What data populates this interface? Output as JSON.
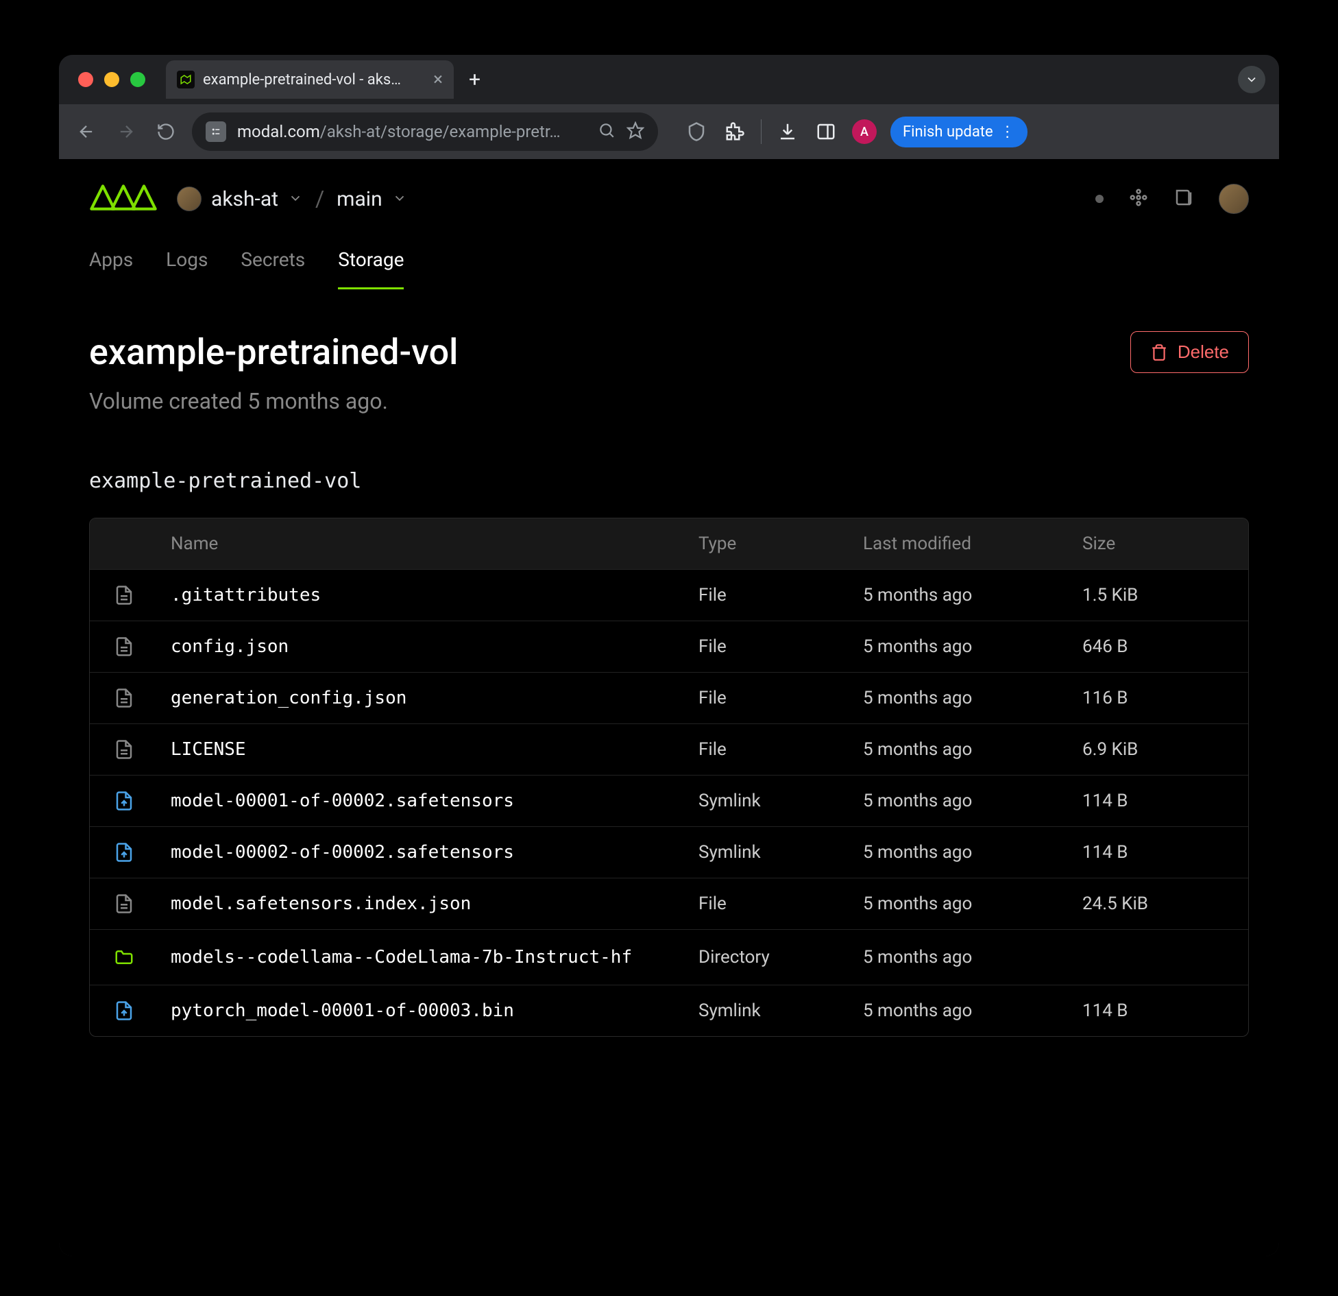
{
  "browser": {
    "tab_title": "example-pretrained-vol - aks…",
    "url_host": "modal.com",
    "url_path": "/aksh-at/storage/example-pretr…",
    "finish_update_label": "Finish update",
    "profile_initial": "A"
  },
  "header": {
    "org": "aksh-at",
    "env": "main"
  },
  "nav": {
    "tabs": [
      "Apps",
      "Logs",
      "Secrets",
      "Storage"
    ],
    "active": "Storage"
  },
  "page": {
    "title": "example-pretrained-vol",
    "subtitle": "Volume created 5 months ago.",
    "breadcrumb": "example-pretrained-vol",
    "delete_label": "Delete"
  },
  "table": {
    "columns": [
      "Name",
      "Type",
      "Last modified",
      "Size"
    ],
    "rows": [
      {
        "icon": "file",
        "name": ".gitattributes",
        "type": "File",
        "modified": "5 months ago",
        "size": "1.5 KiB"
      },
      {
        "icon": "file",
        "name": "config.json",
        "type": "File",
        "modified": "5 months ago",
        "size": "646 B"
      },
      {
        "icon": "file",
        "name": "generation_config.json",
        "type": "File",
        "modified": "5 months ago",
        "size": "116 B"
      },
      {
        "icon": "file",
        "name": "LICENSE",
        "type": "File",
        "modified": "5 months ago",
        "size": "6.9 KiB"
      },
      {
        "icon": "symlink",
        "name": "model-00001-of-00002.safetensors",
        "type": "Symlink",
        "modified": "5 months ago",
        "size": "114 B"
      },
      {
        "icon": "symlink",
        "name": "model-00002-of-00002.safetensors",
        "type": "Symlink",
        "modified": "5 months ago",
        "size": "114 B"
      },
      {
        "icon": "file",
        "name": "model.safetensors.index.json",
        "type": "File",
        "modified": "5 months ago",
        "size": "24.5 KiB"
      },
      {
        "icon": "folder",
        "name": "models--codellama--CodeLlama-7b-Instruct-hf",
        "type": "Directory",
        "modified": "5 months ago",
        "size": ""
      },
      {
        "icon": "symlink",
        "name": "pytorch_model-00001-of-00003.bin",
        "type": "Symlink",
        "modified": "5 months ago",
        "size": "114 B"
      }
    ]
  }
}
